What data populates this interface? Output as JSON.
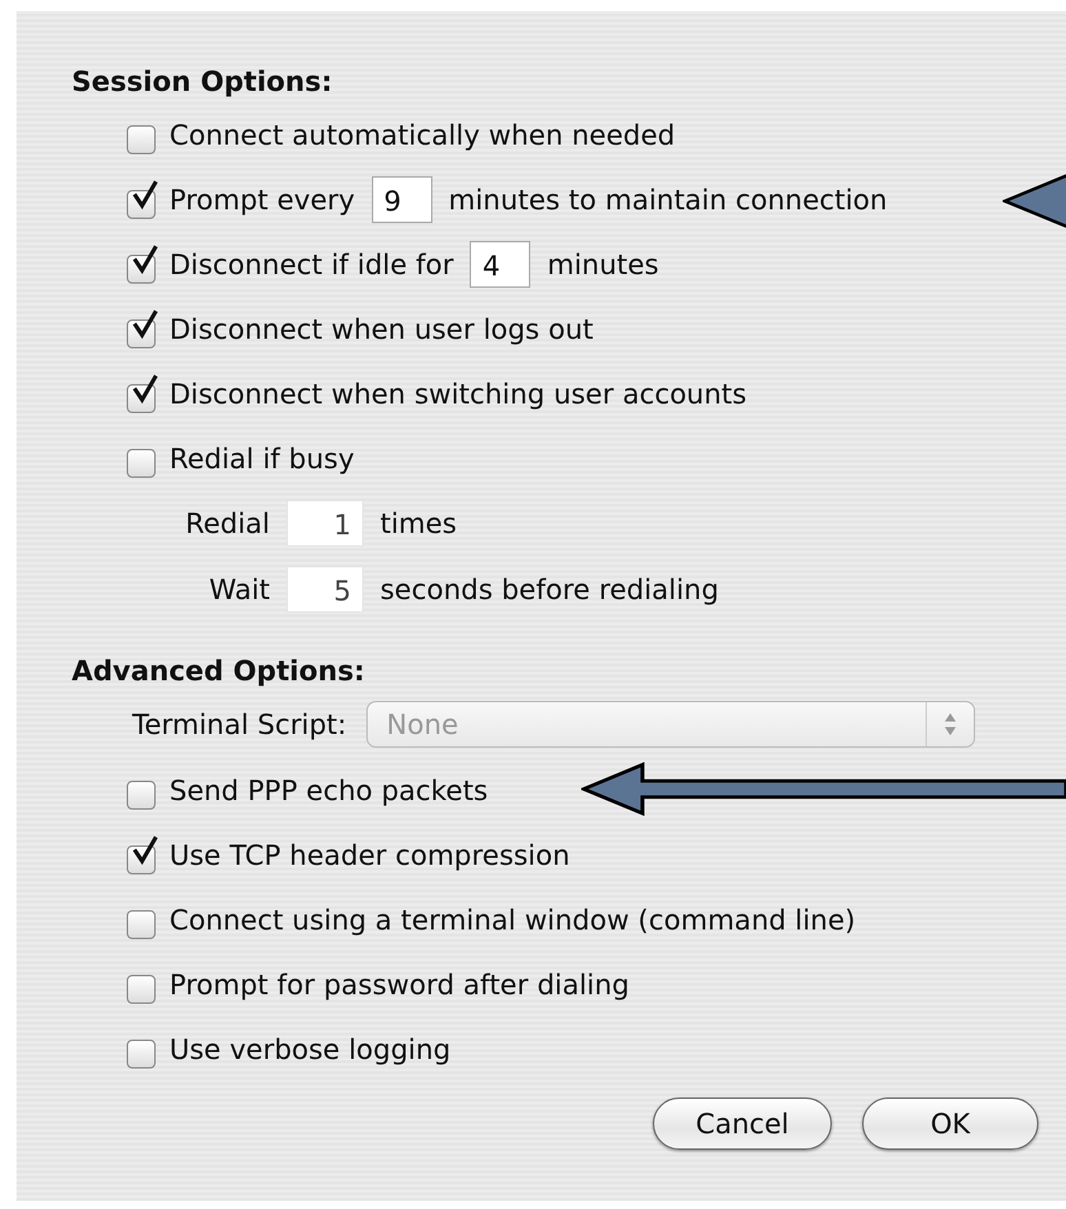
{
  "sections": [
    {
      "heading": "Session Options:",
      "rows": [
        {
          "kind": "checkbox",
          "checked": false,
          "label": "Connect automatically when needed"
        },
        {
          "kind": "checkbox_field",
          "checked": true,
          "before": "Prompt every",
          "value": "9",
          "after": "minutes to maintain connection",
          "arrow": true
        },
        {
          "kind": "checkbox_field",
          "checked": true,
          "before": "Disconnect if idle for",
          "value": "4",
          "after": "minutes"
        },
        {
          "kind": "checkbox",
          "checked": true,
          "label": "Disconnect when user logs out"
        },
        {
          "kind": "checkbox",
          "checked": true,
          "label": "Disconnect when switching user accounts"
        },
        {
          "kind": "checkbox",
          "checked": false,
          "label": "Redial if busy"
        },
        {
          "kind": "field",
          "before": "Redial",
          "value": "1",
          "after": "times"
        },
        {
          "kind": "field",
          "before": "Wait",
          "value": "5",
          "after": "seconds before redialing"
        }
      ]
    },
    {
      "heading": "Advanced Options:",
      "rows": [
        {
          "kind": "popup",
          "label": "Terminal Script:",
          "value": "None",
          "disabled": true
        },
        {
          "kind": "checkbox",
          "checked": false,
          "label": "Send PPP echo packets",
          "arrow": true
        },
        {
          "kind": "checkbox",
          "checked": true,
          "label": "Use TCP header compression"
        },
        {
          "kind": "checkbox",
          "checked": false,
          "label": "Connect using a terminal window (command line)"
        },
        {
          "kind": "checkbox",
          "checked": false,
          "label": "Prompt for password after dialing"
        },
        {
          "kind": "checkbox",
          "checked": false,
          "label": "Use verbose logging"
        }
      ]
    }
  ],
  "buttons": [
    "Cancel",
    "OK"
  ]
}
